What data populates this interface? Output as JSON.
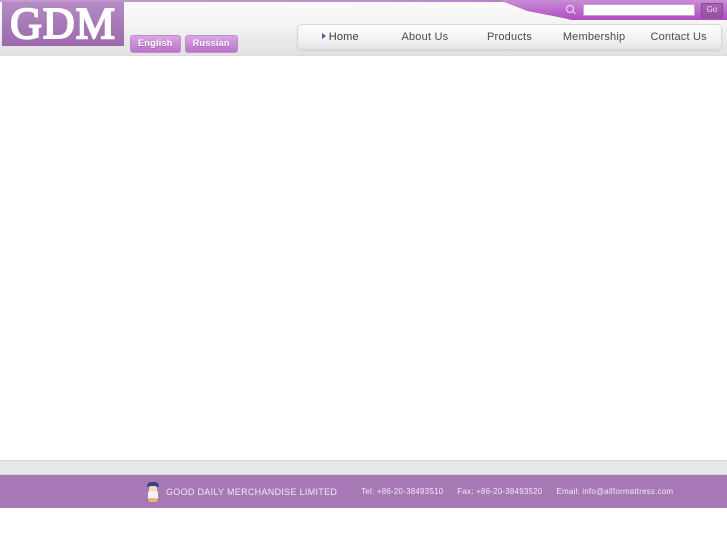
{
  "header": {
    "logo_text": "GDM",
    "languages": [
      {
        "label": "English",
        "name": "english"
      },
      {
        "label": "Russian",
        "name": "russian"
      }
    ],
    "search": {
      "icon": "search-icon",
      "value": "",
      "placeholder": "",
      "go_label": "Go"
    },
    "nav": [
      {
        "label": "Home",
        "active": true
      },
      {
        "label": "About Us",
        "active": false
      },
      {
        "label": "Products",
        "active": false
      },
      {
        "label": "Membership",
        "active": false
      },
      {
        "label": "Contact Us",
        "active": false
      }
    ]
  },
  "footer": {
    "mascot_icon": "mascot-icon",
    "company": "GOOD DAILY MERCHANDISE LIMITED",
    "tel": "Tel: +86-20-38493510",
    "fax": "Fax: +86-20-38493520",
    "email": "Email: info@allformattress.com"
  },
  "colors": {
    "brand_purple": "#a679b6",
    "accent_light": "#cb8ed7",
    "header_bg": "#ededed",
    "nav_text": "#4b4b4b"
  }
}
